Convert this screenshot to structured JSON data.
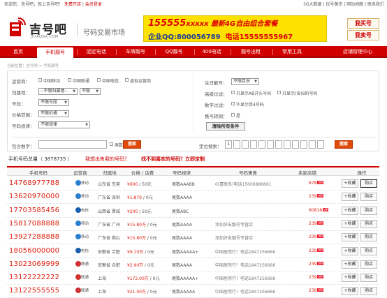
{
  "topbar": {
    "left_text": "欢迎您，吉号吧，就上吉号吧！",
    "register": "免费开店",
    "login": "会员登录",
    "right_text": "3G大数据 | 优号黄页 | 网站地图 | 联系我们"
  },
  "header": {
    "logo_text": "吉号吧",
    "logo_sub": "JIHAOBA.COM",
    "site_subtitle": "号码交易市场",
    "ad_line1_big": "155555",
    "ad_line1_x": "xxxxx",
    "ad_line1_text": " 最新4G自由组合套餐",
    "ad_line2": "企业QQ:800056789",
    "ad_line2_phone": "电话15555555967",
    "buy_button": "我买号",
    "sell_button": "我卖号"
  },
  "nav": {
    "items": [
      "首页",
      "手机靓号",
      "固定电话",
      "车牌靓号",
      "QQ靓号",
      "400电话",
      "靓号出租",
      "常用工具",
      "店铺管理中心"
    ],
    "active_index": 1
  },
  "breadcrumb": "当前位置：吉号吧 > 手机靓号",
  "filters": {
    "carrier_label": "运营商：",
    "carriers": [
      "中国移动",
      "中国联通",
      "中国电信",
      "虚拟运营商"
    ],
    "region_label": "归属地：",
    "region_value": "--不限归属地--",
    "region_city": "不限",
    "segment_label": "号段：",
    "segment_value": "不限号段",
    "price_label": "价格范围：",
    "price_value": "不限价格",
    "rule_label": "号码规律：",
    "rule_value": "不限规律",
    "birthday_label": "生日靓号：",
    "birthday_value": "不限月份",
    "advanced_label": "高级过滤：",
    "advanced_opt1": "只显示AB开头号码",
    "advanced_opt2": "只显示(含)8的号码",
    "digit_label": "数字过滤：",
    "digit_opt": "不显示带4号码",
    "star_label": "携号转网：",
    "star_opt": "是",
    "reset_button": "清除所有条件",
    "contains_label": "包含数字：",
    "contains_opt": "尾数",
    "search_button": "搜索",
    "pos_label": "定位搜索：",
    "pos_first": "1",
    "pos_button": "搜索"
  },
  "results": {
    "count_text": "手机号码总量（ 3878735 ）",
    "link1": "我想出售我的号码？",
    "link2": "找不到喜欢的号码？立即定制"
  },
  "table": {
    "headers": [
      "手机号码",
      "运营商",
      "归属地",
      "价格 / 话费",
      "号码规律",
      "号码寓意",
      "卖家店铺",
      "操作"
    ],
    "fav_label": "+收藏",
    "buy_label": "购买",
    "rows": [
      {
        "number": "14768977788",
        "carrier": "移动",
        "carrier_color": "#2a7fd0",
        "region": "山东省 东营",
        "price": "¥600",
        "fee": "50元",
        "rule": "尾数AAABB",
        "meaning": "0(喜联系)电话15006886661",
        "shop": "678"
      },
      {
        "number": "13620970000",
        "carrier": "移动",
        "carrier_color": "#2a7fd0",
        "region": "广东省 深圳",
        "price": "¥1,870",
        "fee": "0元",
        "rule": "尾数AAAA",
        "meaning": "",
        "shop": "239"
      },
      {
        "number": "17703585456",
        "carrier": "电信",
        "carrier_color": "#1a5fb0",
        "region": "山西省 晋城",
        "price": "¥200",
        "fee": "50元",
        "rule": "尾数ABC",
        "meaning": "",
        "shop": "60818"
      },
      {
        "number": "15817088888",
        "carrier": "移动",
        "carrier_color": "#2a7fd0",
        "region": "广东省 广州",
        "price": "¥15.80万",
        "fee": "0元",
        "rule": "尾数AAAA",
        "meaning": "添加好友靓号专营店",
        "shop": "239"
      },
      {
        "number": "13927288888",
        "carrier": "移动",
        "carrier_color": "#2a7fd0",
        "region": "广东省 佛山",
        "price": "¥15.80万",
        "fee": "0元",
        "rule": "尾数AAAA",
        "meaning": "添加好友靓号专营店",
        "shop": "239"
      },
      {
        "number": "18056000000",
        "carrier": "电信",
        "carrier_color": "#1a5fb0",
        "region": "安徽省 合肥",
        "price": "¥9.10万",
        "fee": "0元",
        "rule": "尾数AAAAA+",
        "meaning": "中国居然行！电话1847256666",
        "shop": "239"
      },
      {
        "number": "13023069999",
        "carrier": "联通",
        "carrier_color": "#d03030",
        "region": "安徽省 合肥",
        "price": "¥2.90万",
        "fee": "0元",
        "rule": "尾数AAAA",
        "meaning": "中国居然行！电话1847256666",
        "shop": "239"
      },
      {
        "number": "13122222222",
        "carrier": "联通",
        "carrier_color": "#d03030",
        "region": "上海",
        "price": "¥172.00万",
        "fee": "0元",
        "rule": "尾数AAAAA+",
        "meaning": "中国居然行！电话1847256666",
        "shop": "239"
      },
      {
        "number": "13122555555",
        "carrier": "联通",
        "carrier_color": "#d03030",
        "region": "上海",
        "price": "¥21.00万",
        "fee": "0元",
        "rule": "尾数AAAAA",
        "meaning": "中国居然行！电话1847256666",
        "shop": "239"
      }
    ]
  }
}
